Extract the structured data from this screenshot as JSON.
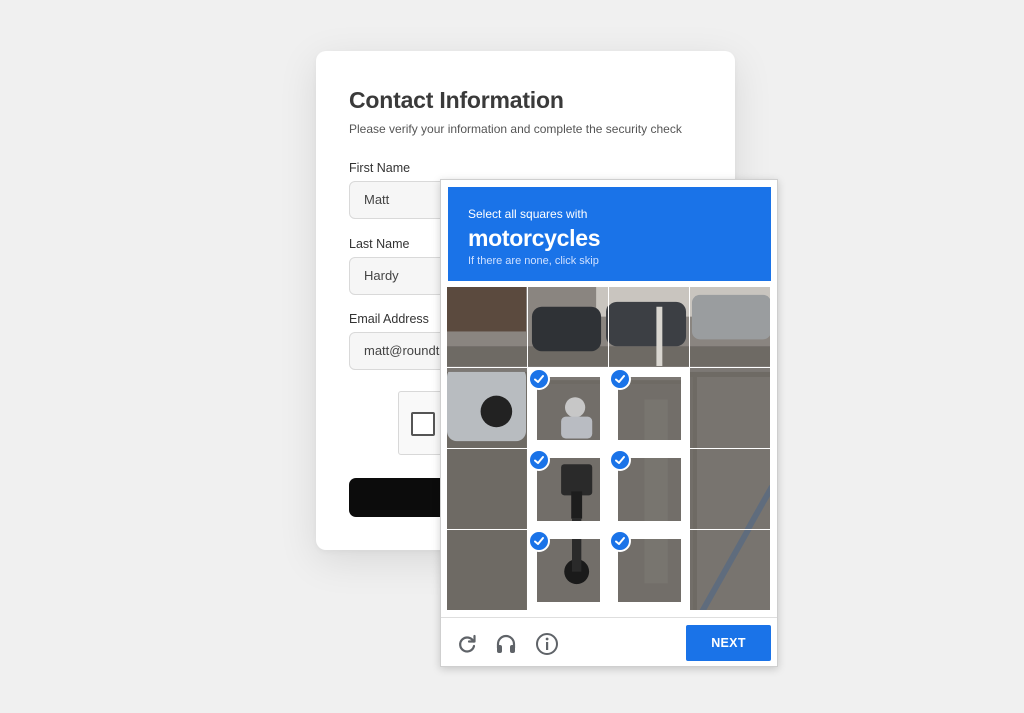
{
  "form": {
    "title": "Contact Information",
    "subtitle": "Please verify your information and complete the security check",
    "fields": [
      {
        "label": "First Name",
        "value": "Matt"
      },
      {
        "label": "Last Name",
        "value": "Hardy"
      },
      {
        "label": "Email Address",
        "value": "matt@roundta"
      }
    ]
  },
  "challenge": {
    "instruction": "Select all squares with",
    "target": "motorcycles",
    "hint": "If there are none, click skip",
    "tiles_selected": [
      false,
      false,
      false,
      false,
      false,
      true,
      true,
      false,
      false,
      true,
      true,
      false,
      false,
      true,
      true,
      false
    ],
    "next_label": "NEXT",
    "icons": [
      "reload-icon",
      "headphones-icon",
      "info-icon"
    ],
    "accent_color": "#1a73e8"
  }
}
